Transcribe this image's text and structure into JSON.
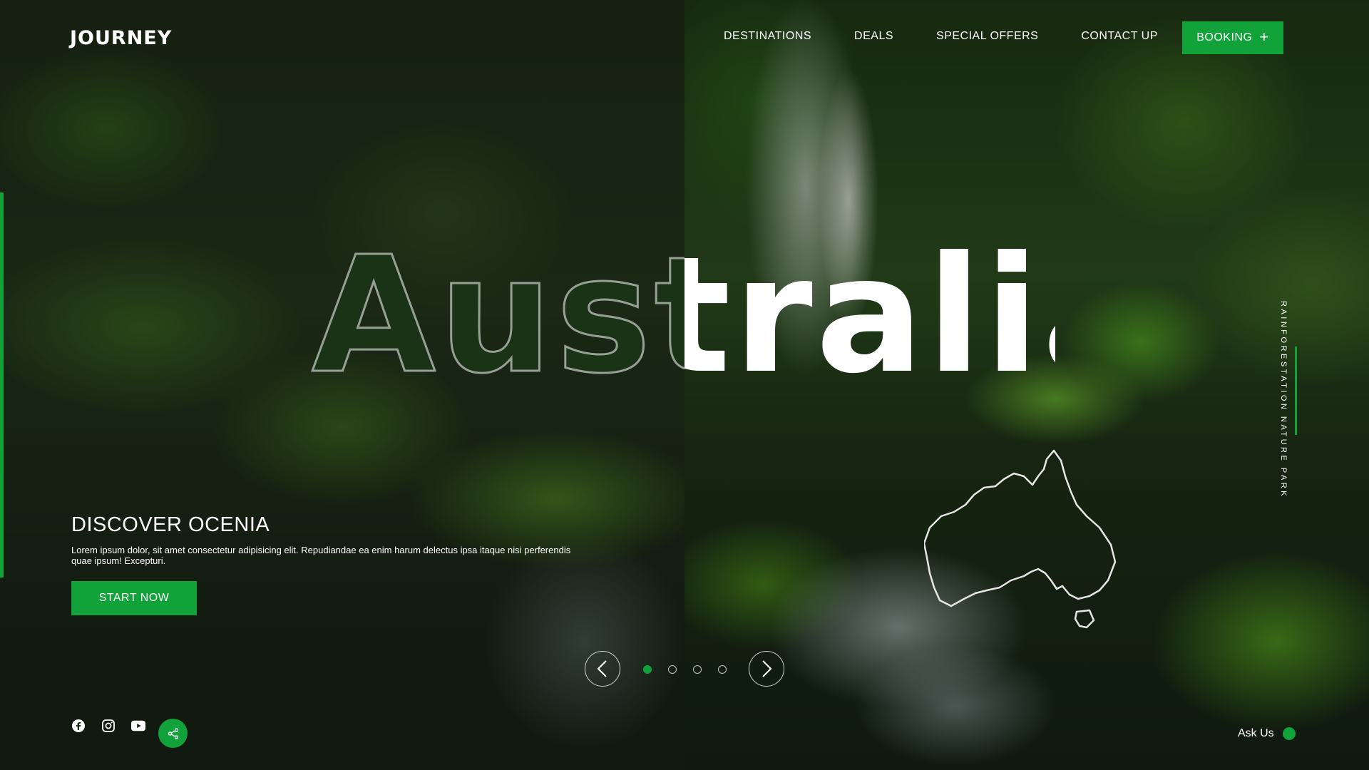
{
  "brand": {
    "logo": "JOURNEY"
  },
  "nav": {
    "items": [
      "DESTINATIONS",
      "DEALS",
      "SPECIAL OFFERS",
      "CONTACT UP"
    ],
    "booking_label": "BOOKING"
  },
  "hero": {
    "title": "Australia",
    "heading": "DISCOVER OCENIA",
    "description": "Lorem ipsum dolor, sit amet consectetur adipisicing elit. Repudiandae ea enim harum delectus ipsa itaque nisi perferendis quae ipsum! Excepturi.",
    "cta_label": "START NOW"
  },
  "slider": {
    "slide_count": 4,
    "active_index": 0
  },
  "side_label": "RAINFORESTATION NATURE PARK",
  "ask": {
    "label": "Ask Us"
  },
  "icons": {
    "social": [
      "facebook-icon",
      "instagram-icon",
      "youtube-icon"
    ],
    "share": "share-icon",
    "prev": "chevron-left-icon",
    "next": "chevron-right-icon",
    "booking": "plus-icon"
  },
  "colors": {
    "accent": "#11a23a",
    "text": "#ffffff"
  }
}
